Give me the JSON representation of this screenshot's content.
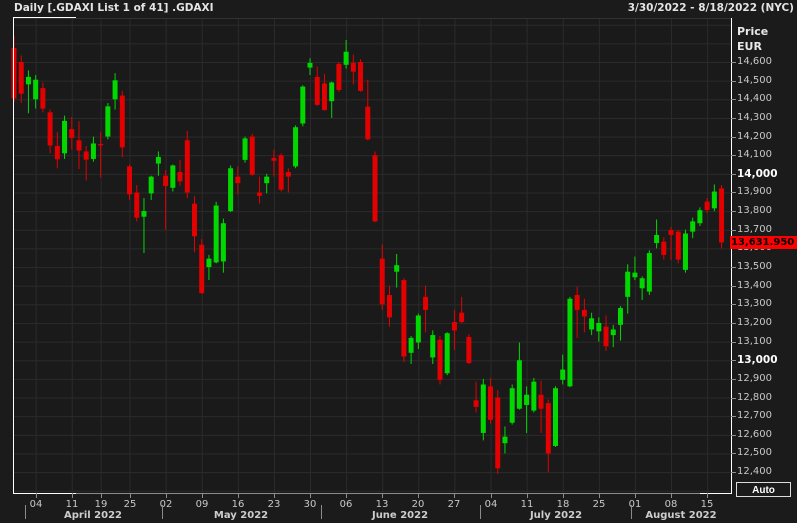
{
  "header": {
    "title": "Daily [.GDAXI List 1 of 41] .GDAXI",
    "date_range": "3/30/2022 - 8/18/2022 (NYC)"
  },
  "right_axis": {
    "title_line1": "Price",
    "title_line2": "EUR",
    "ticks": [
      14600,
      14500,
      14400,
      14300,
      14200,
      14100,
      14000,
      13900,
      13800,
      13700,
      13600,
      13500,
      13400,
      13300,
      13200,
      13100,
      13000,
      12900,
      12800,
      12700,
      12600,
      12500,
      12400
    ],
    "bold_ticks": [
      14000,
      13000
    ],
    "last_price": {
      "label": "13,631.950",
      "value": 13631.95
    }
  },
  "bottom_axis": {
    "week_ticks": [
      {
        "label": "04",
        "index": 3
      },
      {
        "label": "11",
        "index": 8
      },
      {
        "label": "19",
        "index": 12
      },
      {
        "label": "25",
        "index": 16
      },
      {
        "label": "02",
        "index": 21
      },
      {
        "label": "09",
        "index": 26
      },
      {
        "label": "16",
        "index": 31
      },
      {
        "label": "23",
        "index": 36
      },
      {
        "label": "30",
        "index": 41
      },
      {
        "label": "06",
        "index": 46
      },
      {
        "label": "13",
        "index": 51
      },
      {
        "label": "20",
        "index": 56
      },
      {
        "label": "27",
        "index": 61
      },
      {
        "label": "04",
        "index": 66
      },
      {
        "label": "11",
        "index": 71
      },
      {
        "label": "18",
        "index": 76
      },
      {
        "label": "25",
        "index": 81
      },
      {
        "label": "01",
        "index": 86
      },
      {
        "label": "08",
        "index": 91
      },
      {
        "label": "15",
        "index": 96
      }
    ],
    "months": [
      {
        "label": "April 2022",
        "sep_index": 1.5
      },
      {
        "label": "May 2022",
        "sep_index": 20.5
      },
      {
        "label": "June 2022",
        "sep_index": 42.5
      },
      {
        "label": "July 2022",
        "sep_index": 64.5
      },
      {
        "label": "August 2022",
        "sep_index": 85.5
      }
    ]
  },
  "auto_button": {
    "label": "Auto"
  },
  "colors": {
    "up": "#00d800",
    "down": "#e30000",
    "grid": "#2b2b2b",
    "last_price_bg": "#ff0000",
    "background": "#1b1b1b"
  },
  "chart_data": {
    "type": "candlestick",
    "title": "Daily [.GDAXI List 1 of 41] .GDAXI",
    "symbol": ".GDAXI",
    "interval": "Daily",
    "currency": "EUR",
    "ylabel": "Price EUR",
    "ylim": [
      12290,
      14835
    ],
    "grid_step": 100,
    "last_price": 13631.95,
    "legend_position": "none",
    "grid": true,
    "dates": [
      "2022-03-30",
      "2022-03-31",
      "2022-04-01",
      "2022-04-04",
      "2022-04-05",
      "2022-04-06",
      "2022-04-07",
      "2022-04-08",
      "2022-04-11",
      "2022-04-12",
      "2022-04-13",
      "2022-04-14",
      "2022-04-19",
      "2022-04-20",
      "2022-04-21",
      "2022-04-22",
      "2022-04-25",
      "2022-04-26",
      "2022-04-27",
      "2022-04-28",
      "2022-04-29",
      "2022-05-02",
      "2022-05-03",
      "2022-05-04",
      "2022-05-05",
      "2022-05-06",
      "2022-05-09",
      "2022-05-10",
      "2022-05-11",
      "2022-05-12",
      "2022-05-13",
      "2022-05-16",
      "2022-05-17",
      "2022-05-18",
      "2022-05-19",
      "2022-05-20",
      "2022-05-23",
      "2022-05-24",
      "2022-05-25",
      "2022-05-26",
      "2022-05-27",
      "2022-05-30",
      "2022-05-31",
      "2022-06-01",
      "2022-06-02",
      "2022-06-03",
      "2022-06-06",
      "2022-06-07",
      "2022-06-08",
      "2022-06-09",
      "2022-06-10",
      "2022-06-13",
      "2022-06-14",
      "2022-06-15",
      "2022-06-16",
      "2022-06-17",
      "2022-06-20",
      "2022-06-21",
      "2022-06-22",
      "2022-06-23",
      "2022-06-24",
      "2022-06-27",
      "2022-06-28",
      "2022-06-29",
      "2022-06-30",
      "2022-07-01",
      "2022-07-04",
      "2022-07-05",
      "2022-07-06",
      "2022-07-07",
      "2022-07-08",
      "2022-07-11",
      "2022-07-12",
      "2022-07-13",
      "2022-07-14",
      "2022-07-15",
      "2022-07-18",
      "2022-07-19",
      "2022-07-20",
      "2022-07-21",
      "2022-07-22",
      "2022-07-25",
      "2022-07-26",
      "2022-07-27",
      "2022-07-28",
      "2022-07-29",
      "2022-08-01",
      "2022-08-02",
      "2022-08-03",
      "2022-08-04",
      "2022-08-05",
      "2022-08-08",
      "2022-08-09",
      "2022-08-10",
      "2022-08-11",
      "2022-08-12",
      "2022-08-15",
      "2022-08-16",
      "2022-08-17"
    ],
    "ohlc": [
      [
        14675,
        14740,
        14385,
        14405
      ],
      [
        14600,
        14635,
        14380,
        14430
      ],
      [
        14480,
        14555,
        14325,
        14520
      ],
      [
        14400,
        14530,
        14350,
        14505
      ],
      [
        14460,
        14490,
        14330,
        14350
      ],
      [
        14330,
        14345,
        14110,
        14152
      ],
      [
        14150,
        14225,
        14030,
        14078
      ],
      [
        14110,
        14312,
        14080,
        14284
      ],
      [
        14240,
        14305,
        14130,
        14193
      ],
      [
        14180,
        14282,
        14025,
        14125
      ],
      [
        14120,
        14150,
        13965,
        14076
      ],
      [
        14080,
        14200,
        14065,
        14163
      ],
      [
        14160,
        14225,
        13980,
        14153
      ],
      [
        14200,
        14380,
        14185,
        14362
      ],
      [
        14400,
        14540,
        14345,
        14502
      ],
      [
        14420,
        14445,
        14090,
        14142
      ],
      [
        14040,
        14050,
        13860,
        13890
      ],
      [
        13900,
        13940,
        13745,
        13765
      ],
      [
        13770,
        13870,
        13575,
        13800
      ],
      [
        13895,
        13990,
        13860,
        13985
      ],
      [
        14055,
        14120,
        13990,
        14090
      ],
      [
        13990,
        14020,
        13700,
        13935
      ],
      [
        13925,
        14050,
        13905,
        14045
      ],
      [
        14010,
        14075,
        13935,
        13960
      ],
      [
        14180,
        14230,
        13870,
        13900
      ],
      [
        13840,
        13880,
        13580,
        13665
      ],
      [
        13620,
        13650,
        13355,
        13360
      ],
      [
        13500,
        13565,
        13430,
        13545
      ],
      [
        13525,
        13850,
        13520,
        13830
      ],
      [
        13530,
        13760,
        13470,
        13735
      ],
      [
        13800,
        14045,
        13795,
        14030
      ],
      [
        13985,
        14040,
        13890,
        13950
      ],
      [
        14075,
        14200,
        14060,
        14190
      ],
      [
        14200,
        14215,
        13990,
        13995
      ],
      [
        13900,
        13985,
        13840,
        13882
      ],
      [
        13950,
        14000,
        13895,
        13985
      ],
      [
        14085,
        14130,
        13985,
        14070
      ],
      [
        14100,
        14110,
        13905,
        13915
      ],
      [
        14010,
        14030,
        13900,
        13985
      ],
      [
        14040,
        14260,
        14030,
        14250
      ],
      [
        14270,
        14475,
        14255,
        14468
      ],
      [
        14570,
        14620,
        14530,
        14595
      ],
      [
        14520,
        14575,
        14365,
        14370
      ],
      [
        14485,
        14535,
        14340,
        14342
      ],
      [
        14390,
        14495,
        14300,
        14490
      ],
      [
        14590,
        14600,
        14440,
        14450
      ],
      [
        14585,
        14718,
        14565,
        14655
      ],
      [
        14595,
        14640,
        14480,
        14548
      ],
      [
        14600,
        14615,
        14440,
        14445
      ],
      [
        14360,
        14505,
        14180,
        14185
      ],
      [
        14100,
        14120,
        13740,
        13745
      ],
      [
        13545,
        13620,
        13270,
        13300
      ],
      [
        13350,
        13400,
        13180,
        13230
      ],
      [
        13475,
        13570,
        13390,
        13510
      ],
      [
        13430,
        13440,
        12990,
        13020
      ],
      [
        13040,
        13130,
        12980,
        13120
      ],
      [
        13095,
        13250,
        13060,
        13240
      ],
      [
        13340,
        13400,
        13150,
        13270
      ],
      [
        13015,
        13160,
        12980,
        13135
      ],
      [
        13110,
        13130,
        12870,
        12895
      ],
      [
        12930,
        13150,
        12920,
        13145
      ],
      [
        13205,
        13270,
        13055,
        13160
      ],
      [
        13255,
        13340,
        13200,
        13205
      ],
      [
        13125,
        13140,
        12980,
        12985
      ],
      [
        12785,
        12885,
        12720,
        12750
      ],
      [
        12610,
        12900,
        12570,
        12870
      ],
      [
        12860,
        12905,
        12660,
        12680
      ],
      [
        12800,
        12840,
        12390,
        12420
      ],
      [
        12555,
        12645,
        12500,
        12590
      ],
      [
        12665,
        12870,
        12655,
        12850
      ],
      [
        12740,
        13095,
        12735,
        13000
      ],
      [
        12760,
        12860,
        12610,
        12815
      ],
      [
        12730,
        12905,
        12720,
        12885
      ],
      [
        12815,
        12890,
        12610,
        12740
      ],
      [
        12770,
        12790,
        12400,
        12500
      ],
      [
        12540,
        12860,
        12535,
        12850
      ],
      [
        12895,
        13030,
        12870,
        12950
      ],
      [
        12860,
        13340,
        12855,
        13330
      ],
      [
        13350,
        13395,
        13120,
        13270
      ],
      [
        13270,
        13330,
        13150,
        13235
      ],
      [
        13165,
        13255,
        13135,
        13225
      ],
      [
        13155,
        13230,
        13100,
        13200
      ],
      [
        13180,
        13240,
        13050,
        13075
      ],
      [
        13135,
        13190,
        13070,
        13165
      ],
      [
        13190,
        13290,
        13105,
        13280
      ],
      [
        13340,
        13515,
        13250,
        13475
      ],
      [
        13445,
        13556,
        13430,
        13470
      ],
      [
        13386,
        13450,
        13323,
        13440
      ],
      [
        13368,
        13590,
        13350,
        13575
      ],
      [
        13629,
        13755,
        13600,
        13672
      ],
      [
        13636,
        13660,
        13540,
        13565
      ],
      [
        13699,
        13715,
        13538,
        13672
      ],
      [
        13690,
        13700,
        13520,
        13540
      ],
      [
        13485,
        13700,
        13470,
        13680
      ],
      [
        13690,
        13765,
        13655,
        13745
      ],
      [
        13735,
        13820,
        13720,
        13805
      ],
      [
        13851,
        13870,
        13790,
        13806
      ],
      [
        13815,
        13943,
        13800,
        13905
      ],
      [
        13922,
        13940,
        13600,
        13632
      ]
    ]
  }
}
